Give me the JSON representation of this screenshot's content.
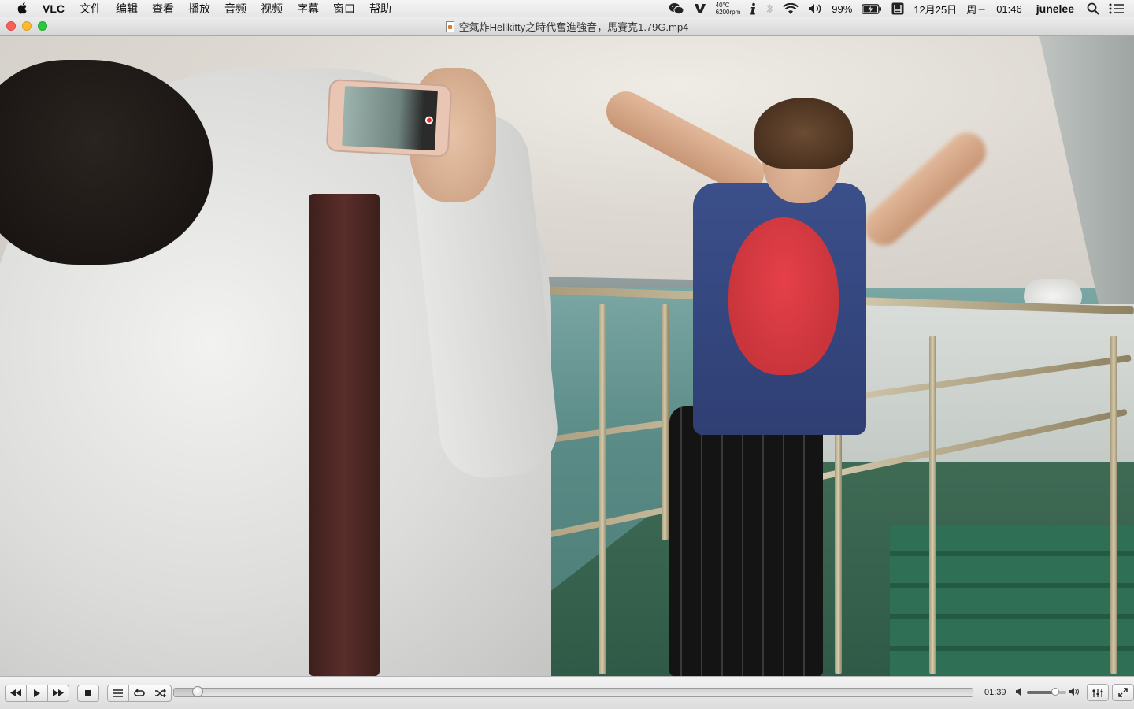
{
  "menubar": {
    "app_name": "VLC",
    "items": [
      "文件",
      "编辑",
      "查看",
      "播放",
      "音频",
      "视频",
      "字幕",
      "窗口",
      "帮助"
    ],
    "status": {
      "temperature": "40°C",
      "fan": "6200rpm",
      "battery": "99%",
      "date": "12月25日",
      "weekday": "周三",
      "time": "01:46",
      "user": "junelee"
    }
  },
  "window": {
    "title": "空氣炸Hellkitty之時代奮進強音，馬賽克1.79G.mp4"
  },
  "controller": {
    "elapsed": "01:39",
    "progress": 0.03,
    "volume": 0.72,
    "icons": [
      "rewind-icon",
      "play-icon",
      "fast-forward-icon",
      "stop-icon",
      "playlist-icon",
      "loop-icon",
      "shuffle-icon",
      "volume-low-icon",
      "volume-high-icon",
      "equalizer-icon",
      "fullscreen-icon"
    ]
  }
}
